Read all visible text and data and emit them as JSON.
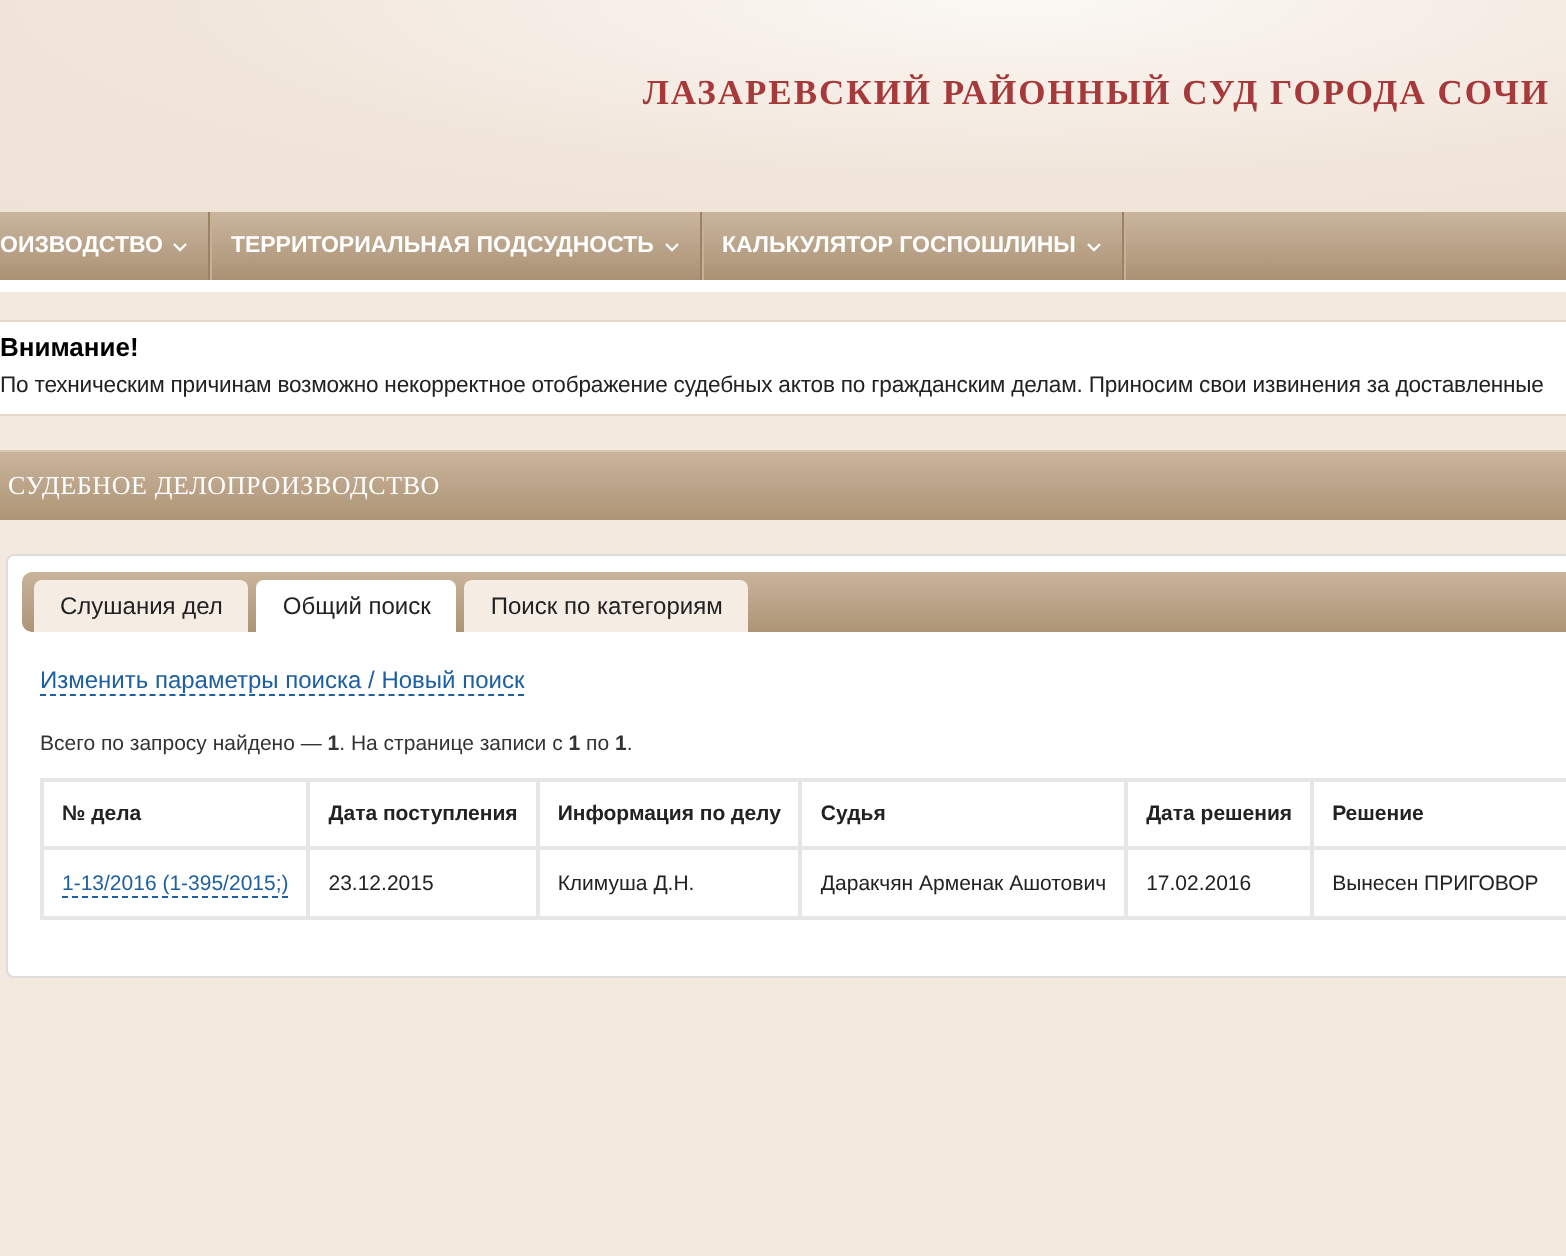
{
  "site_title": "ЛАЗАРЕВСКИЙ РАЙОННЫЙ СУД ГОРОДА СОЧИ",
  "nav": [
    {
      "label": "ОИЗВОДСТВО",
      "dropdown": true
    },
    {
      "label": "ТЕРРИТОРИАЛЬНАЯ ПОДСУДНОСТЬ",
      "dropdown": true
    },
    {
      "label": "КАЛЬКУЛЯТОР ГОСПОШЛИНЫ",
      "dropdown": true
    }
  ],
  "notice": {
    "title": "Внимание!",
    "text": "По техническим причинам возможно некорректное отображение судебных актов по гражданским делам. Приносим свои извинения за доставленные"
  },
  "section_title": "СУДЕБНОЕ ДЕЛОПРОИЗВОДСТВО",
  "tabs": [
    {
      "label": "Слушания дел",
      "selected": false
    },
    {
      "label": "Общий поиск",
      "selected": true
    },
    {
      "label": "Поиск по категориям",
      "selected": false
    }
  ],
  "search_link": "Изменить параметры поиска / Новый поиск",
  "summary": "Всего по запросу найдено — **1**. На странице записи с **1** по **1**.",
  "table": {
    "columns": [
      "№ дела",
      "Дата поступления",
      "Информация по делу",
      "Судья",
      "Дата решения",
      "Решение"
    ],
    "rows": [
      [
        "1-13/2016 (1-395/2015;)",
        "23.12.2015",
        "Климуша Д.Н.",
        "Даракчян Арменак Ашотович",
        "17.02.2016",
        "Вынесен ПРИГОВОР"
      ]
    ]
  }
}
